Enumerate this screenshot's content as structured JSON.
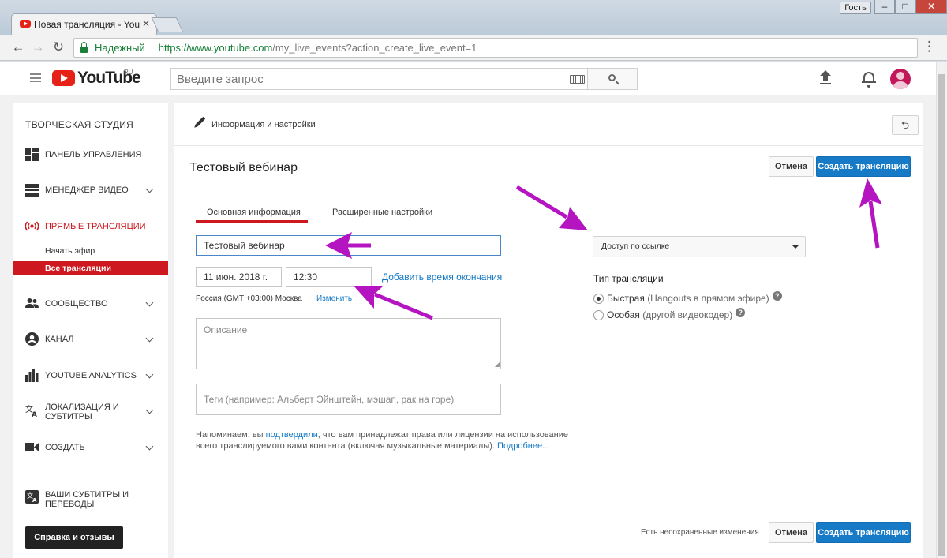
{
  "browser": {
    "tab_title": "Новая трансляция - You",
    "guest_label": "Гость",
    "secure_label": "Надежный",
    "url_host": "https://www.youtube.com",
    "url_path": "/my_live_events?action_create_live_event=1"
  },
  "header": {
    "logo_text": "YouTube",
    "logo_region": "RU",
    "search_placeholder": "Введите запрос"
  },
  "sidebar": {
    "title": "ТВОРЧЕСКАЯ СТУДИЯ",
    "items": [
      {
        "label": "ПАНЕЛЬ УПРАВЛЕНИЯ",
        "icon": "dashboard-icon"
      },
      {
        "label": "МЕНЕДЖЕР ВИДЕО",
        "icon": "video-manager-icon"
      },
      {
        "label": "ПРЯМЫЕ ТРАНСЛЯЦИИ",
        "icon": "live-icon"
      },
      {
        "label": "СООБЩЕСТВО",
        "icon": "community-icon"
      },
      {
        "label": "КАНАЛ",
        "icon": "channel-icon"
      },
      {
        "label": "YOUTUBE ANALYTICS",
        "icon": "analytics-icon"
      },
      {
        "label": "ЛОКАЛИЗАЦИЯ И СУБТИТРЫ",
        "icon": "translate-icon"
      },
      {
        "label": "СОЗДАТЬ",
        "icon": "create-icon"
      },
      {
        "label": "ВАШИ СУБТИТРЫ И ПЕРЕВОДЫ",
        "icon": "subtitles-icon"
      }
    ],
    "live_sub": [
      "Начать эфир",
      "Все трансляции"
    ],
    "help_button": "Справка и отзывы"
  },
  "main": {
    "section_title": "Информация и настройки",
    "event_title": "Тестовый вебинар",
    "cancel_label": "Отмена",
    "create_label": "Создать трансляцию",
    "tabs": [
      "Основная информация",
      "Расширенные настройки"
    ],
    "title_value": "Тестовый вебинар",
    "date_value": "11 июн. 2018 г.",
    "time_value": "12:30",
    "add_end_time": "Добавить время окончания",
    "timezone": "Россия (GMT +03:00) Москва",
    "timezone_change": "Изменить",
    "description_placeholder": "Описание",
    "tags_placeholder": "Теги (например: Альберт Эйнштейн, мэшап, рак на горе)",
    "notice_prefix": "Напоминаем: вы ",
    "notice_link": "подтвердили",
    "notice_middle": ", что вам принадлежат права или лицензии на использование всего транслируемого вами контента (включая музыкальные материалы). ",
    "notice_more": "Подробнее...",
    "privacy_selected": "Доступ по ссылке",
    "stream_type_label": "Тип трансляции",
    "radio_fast": "Быстрая",
    "radio_fast_note": "(Hangouts в прямом эфире)",
    "radio_custom": "Особая",
    "radio_custom_note": "(другой видеокодер)",
    "unsaved_text": "Есть несохраненные изменения."
  },
  "colors": {
    "brand_red": "#e62117",
    "accent_blue": "#167ac6",
    "arrow_magenta": "#b514c1"
  }
}
